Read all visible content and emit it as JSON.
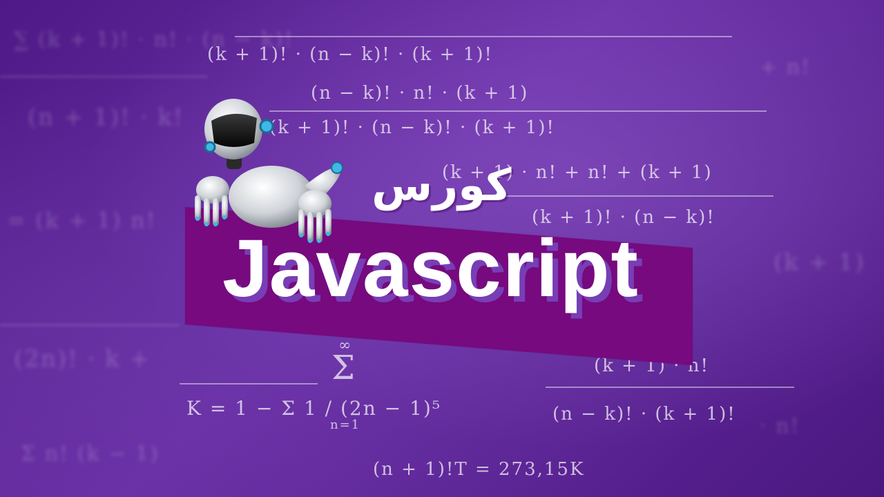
{
  "thumbnail": {
    "title_arabic": "كورس",
    "title_main": "Javascript"
  },
  "background_math": {
    "lines": [
      "(k + 1)!  ·  (n − k)!  ·  (k + 1)!",
      "(n − k)!  ·  n!  ·  (k + 1)",
      "(k + 1)!  ·  (n − k)!  ·  (k + 1)!",
      "(k + 1)  ·  n!  +  n!  +  (k + 1)",
      "(k + 1)!  ·  (n − k)!",
      "(k + 1)  ·  n!",
      "K = 1 − Σ  1 / (2n − 1)⁵",
      "(n − k)!  ·  (k + 1)!",
      "(n + 1)!T  =  273,15K"
    ],
    "sum_symbol": "Σ",
    "infinity": "∞",
    "index_start": "n=1"
  },
  "colors": {
    "background": "#5a2290",
    "banner": "#760a7e",
    "title_text": "#ffffff",
    "title_shadow": "#7850c8"
  },
  "icons": {
    "robot": "robot-mascot"
  }
}
